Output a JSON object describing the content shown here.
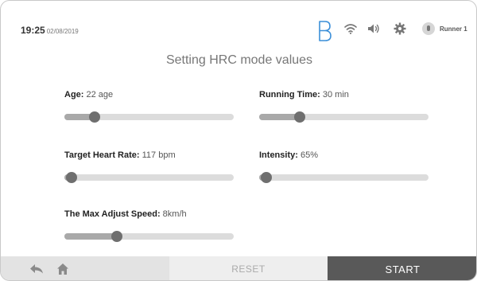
{
  "status_bar": {
    "time": "19:25",
    "date": "02/08/2019",
    "user_name": "Runner 1",
    "icons": [
      "bluetooth-icon",
      "wifi-icon",
      "volume-icon",
      "gear-icon",
      "user-icon"
    ]
  },
  "page": {
    "title": "Setting HRC mode values"
  },
  "settings": {
    "age": {
      "label": "Age",
      "separator": ":",
      "value": " 22 age",
      "level": 0.18
    },
    "running_time": {
      "label": "Running Time",
      "separator": ":",
      "value": " 30 min",
      "level": 0.24
    },
    "target_heart_rate": {
      "label": "Target Heart Rate",
      "separator": ":",
      "value": " 117 bpm",
      "level": 0.04
    },
    "intensity": {
      "label": "Intensity",
      "separator": ":",
      "value": " 65%",
      "level": 0.04
    },
    "max_adjust_speed": {
      "label": "The Max Adjust Speed",
      "separator": ":",
      "value": "  8km/h",
      "level": 0.31
    }
  },
  "bottom_bar": {
    "reset_label": "RESET",
    "start_label": "START"
  },
  "colors": {
    "start_bg": "#595959",
    "reset_bg": "#eeeeee",
    "nav_bg": "#e3e3e3",
    "track": "#dcdcdc",
    "thumb": "#6f6f6f",
    "bluetooth": "#3b8fd9"
  }
}
